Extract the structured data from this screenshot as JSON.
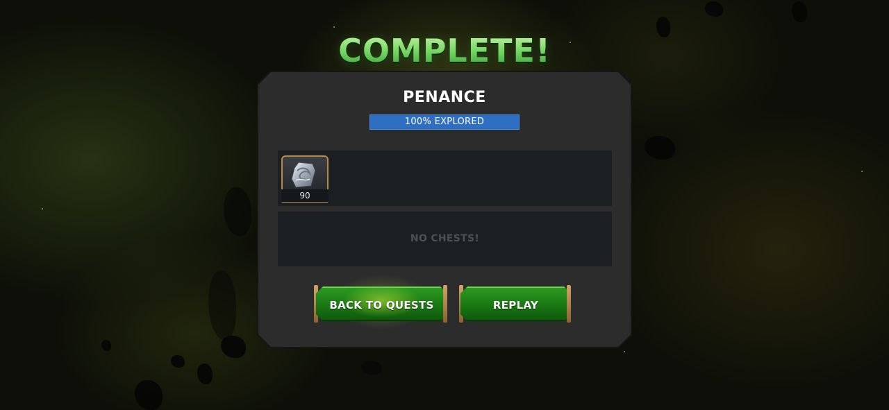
{
  "screen": {
    "title": "COMPLETE!"
  },
  "quest": {
    "name": "PENANCE",
    "progress_label": "100% EXPLORED",
    "progress_percent": 100
  },
  "rewards": {
    "items": [
      {
        "icon": "silver-shard-icon",
        "count": "90"
      }
    ]
  },
  "chests": {
    "empty_label": "NO CHESTS!"
  },
  "buttons": {
    "back_label": "BACK TO QUESTS",
    "replay_label": "REPLAY"
  },
  "colors": {
    "title_green": "#8fe07a",
    "progress_blue": "#2e6fc4",
    "button_green": "#1c7a14",
    "panel_bg": "#2c2c2d",
    "box_bg": "#1b1f22"
  }
}
